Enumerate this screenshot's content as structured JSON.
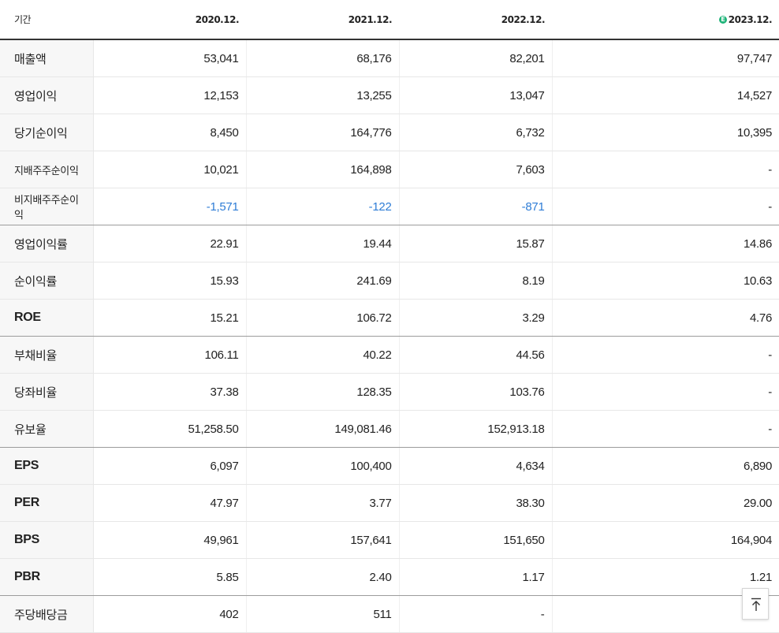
{
  "header": {
    "period_label": "기간",
    "periods": [
      "2020.12.",
      "2021.12.",
      "2022.12.",
      "2023.12."
    ],
    "estimate_badge": "E"
  },
  "rows": [
    {
      "label": "매출액",
      "values": [
        "53,041",
        "68,176",
        "82,201",
        "97,747"
      ]
    },
    {
      "label": "영업이익",
      "values": [
        "12,153",
        "13,255",
        "13,047",
        "14,527"
      ]
    },
    {
      "label": "당기순이익",
      "values": [
        "8,450",
        "164,776",
        "6,732",
        "10,395"
      ]
    },
    {
      "label": "지배주주순이익",
      "values": [
        "10,021",
        "164,898",
        "7,603",
        "-"
      ]
    },
    {
      "label": "비지배주주순이익",
      "values": [
        "-1,571",
        "-122",
        "-871",
        "-"
      ]
    },
    {
      "label": "영업이익률",
      "values": [
        "22.91",
        "19.44",
        "15.87",
        "14.86"
      ]
    },
    {
      "label": "순이익률",
      "values": [
        "15.93",
        "241.69",
        "8.19",
        "10.63"
      ]
    },
    {
      "label": "ROE",
      "values": [
        "15.21",
        "106.72",
        "3.29",
        "4.76"
      ]
    },
    {
      "label": "부채비율",
      "values": [
        "106.11",
        "40.22",
        "44.56",
        "-"
      ]
    },
    {
      "label": "당좌비율",
      "values": [
        "37.38",
        "128.35",
        "103.76",
        "-"
      ]
    },
    {
      "label": "유보율",
      "values": [
        "51,258.50",
        "149,081.46",
        "152,913.18",
        "-"
      ]
    },
    {
      "label": "EPS",
      "values": [
        "6,097",
        "100,400",
        "4,634",
        "6,890"
      ]
    },
    {
      "label": "PER",
      "values": [
        "47.97",
        "3.77",
        "38.30",
        "29.00"
      ]
    },
    {
      "label": "BPS",
      "values": [
        "49,961",
        "157,641",
        "151,650",
        "164,904"
      ]
    },
    {
      "label": "PBR",
      "values": [
        "5.85",
        "2.40",
        "1.17",
        "1.21"
      ]
    },
    {
      "label": "주당배당금",
      "values": [
        "402",
        "511",
        "-",
        ""
      ]
    }
  ],
  "colors": {
    "negative": "#2f7dd6",
    "estimate_badge": "#1fb479"
  },
  "icons": {
    "scroll_top": "arrow-up-to-line-icon"
  }
}
